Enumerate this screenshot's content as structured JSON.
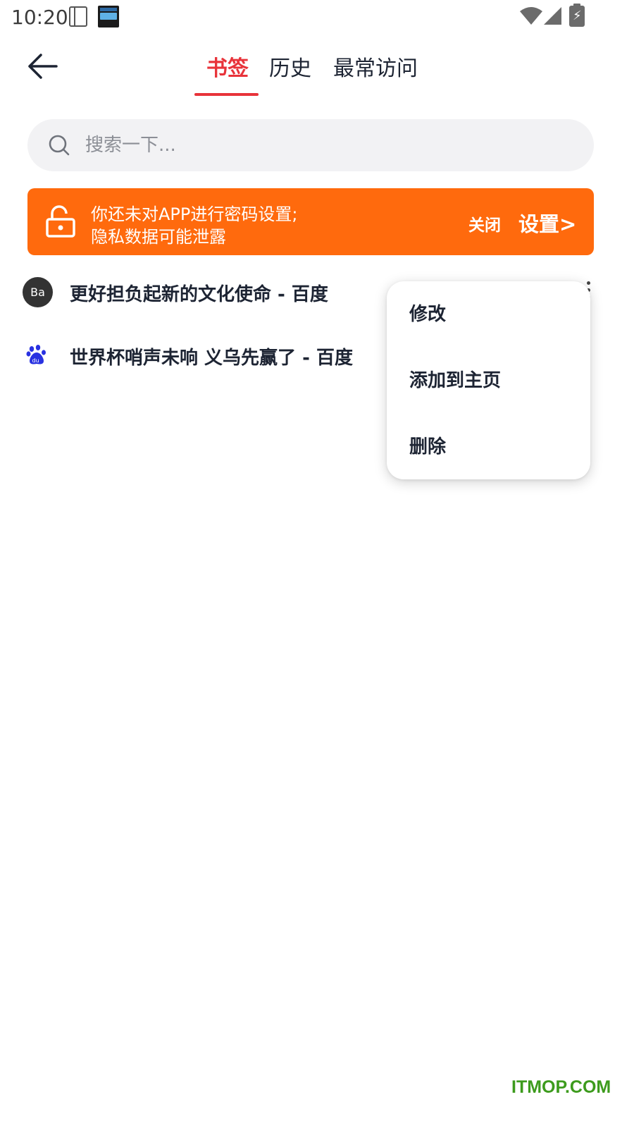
{
  "status_bar": {
    "time": "10:20",
    "icons": [
      "notebook-icon",
      "clock-app-icon",
      "wifi-icon",
      "cellular-signal-icon",
      "battery-charging-icon"
    ]
  },
  "header": {
    "back_icon": "arrow-left-icon",
    "tabs": [
      {
        "label": "书签",
        "active": true
      },
      {
        "label": "历史",
        "active": false
      },
      {
        "label": "最常访问",
        "active": false
      }
    ],
    "accent_color": "#e8333a"
  },
  "search": {
    "placeholder": "搜索一下...",
    "value": "",
    "icon": "search-icon"
  },
  "banner": {
    "line1": "你还未对APP进行密码设置;",
    "line2": "隐私数据可能泄露",
    "close_label": "关闭",
    "settings_label": "设置>",
    "icon": "unlocked-padlock-icon",
    "background_color": "#ff6a0d"
  },
  "bookmarks": [
    {
      "favicon_text": "Ba",
      "title": "更好担负起新的文化使命 - 百度"
    },
    {
      "favicon_icon": "baidu-paw-icon",
      "title": "世界杯哨声未响 义乌先赢了 - 百度"
    }
  ],
  "context_menu": {
    "items": [
      {
        "label": "修改"
      },
      {
        "label": "添加到主页"
      },
      {
        "label": "删除"
      }
    ]
  },
  "watermark": "ITMOP.COM"
}
